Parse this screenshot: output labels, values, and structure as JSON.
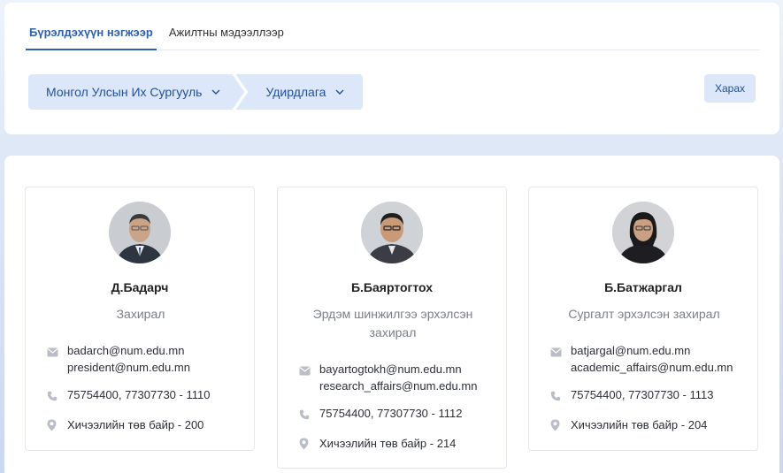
{
  "tabs": [
    {
      "label": "Бүрэлдэхүүн нэгжээр",
      "active": true
    },
    {
      "label": "Ажилтны мэдээллээр",
      "active": false
    }
  ],
  "breadcrumb": {
    "university": "Монгол Улсын Их Сургууль",
    "unit": "Удирдлага"
  },
  "view_button": "Харах",
  "colors": {
    "accent": "#2d5fb6",
    "chip": "#dce8fa"
  },
  "people": [
    {
      "name": "Д.Бадарч",
      "role": "Захирал",
      "emails": [
        "badarch@num.edu.mn",
        "president@num.edu.mn"
      ],
      "phone": "75754400, 77307730 - 1110",
      "office": "Хичээлийн төв байр - 200"
    },
    {
      "name": "Б.Баяртогтох",
      "role": "Эрдэм шинжилгээ эрхэлсэн захирал",
      "emails": [
        "bayartogtokh@num.edu.mn",
        "research_affairs@num.edu.mn"
      ],
      "phone": "75754400, 77307730 - 1112",
      "office": "Хичээлийн төв байр - 214"
    },
    {
      "name": "Б.Батжаргал",
      "role": "Сургалт эрхэлсэн захирал",
      "emails": [
        "batjargal@num.edu.mn",
        "academic_affairs@num.edu.mn"
      ],
      "phone": "75754400, 77307730 - 1113",
      "office": "Хичээлийн төв байр - 204"
    }
  ]
}
